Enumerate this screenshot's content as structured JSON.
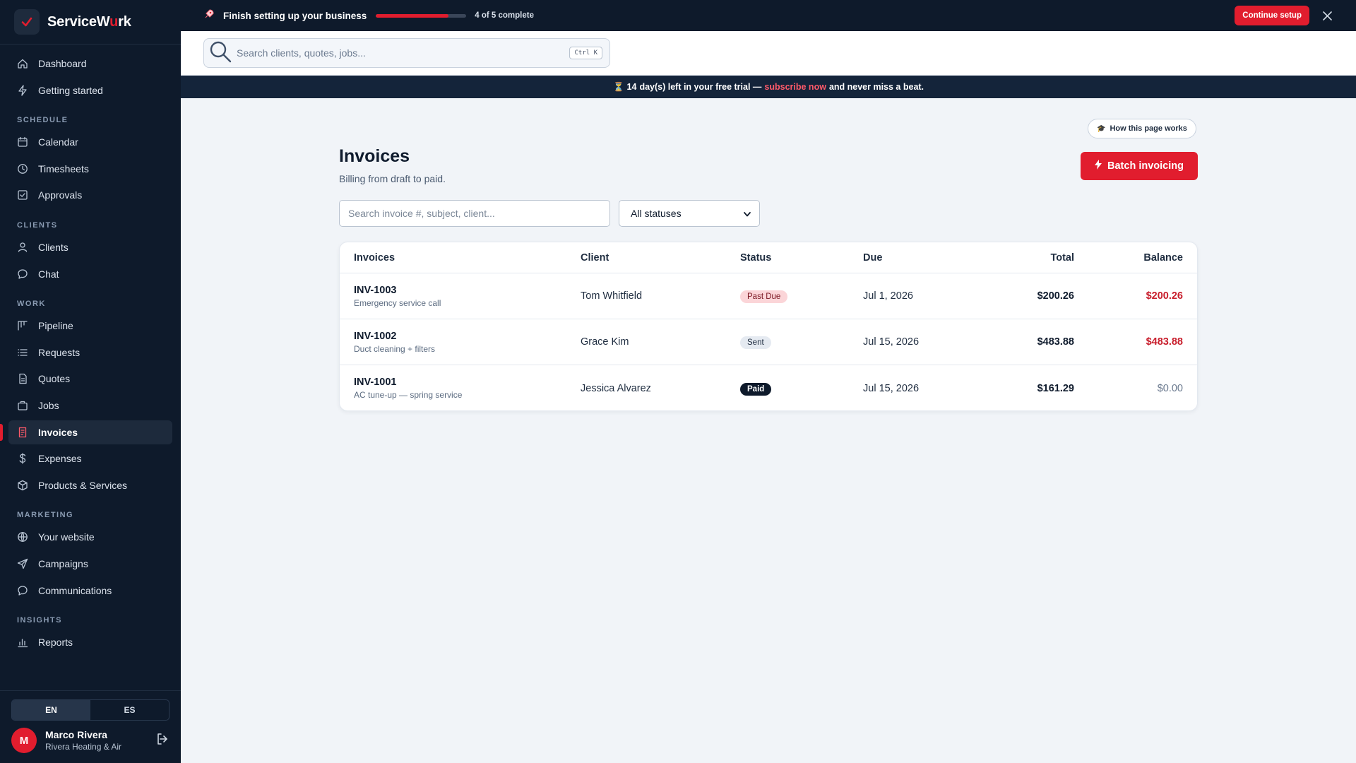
{
  "brand": {
    "name_prefix": "ServiceW",
    "name_accent": "u",
    "name_suffix": "rk"
  },
  "sidebar": {
    "top": [
      {
        "label": "Dashboard",
        "icon": "home-icon"
      },
      {
        "label": "Getting started",
        "icon": "bolt-icon"
      }
    ],
    "sections": [
      {
        "title": "SCHEDULE",
        "items": [
          {
            "label": "Calendar",
            "icon": "calendar-icon"
          },
          {
            "label": "Timesheets",
            "icon": "clock-icon"
          },
          {
            "label": "Approvals",
            "icon": "check-square-icon"
          }
        ]
      },
      {
        "title": "CLIENTS",
        "items": [
          {
            "label": "Clients",
            "icon": "user-icon"
          },
          {
            "label": "Chat",
            "icon": "chat-icon"
          }
        ]
      },
      {
        "title": "WORK",
        "items": [
          {
            "label": "Pipeline",
            "icon": "kanban-icon"
          },
          {
            "label": "Requests",
            "icon": "list-icon"
          },
          {
            "label": "Quotes",
            "icon": "file-icon"
          },
          {
            "label": "Jobs",
            "icon": "briefcase-icon"
          },
          {
            "label": "Invoices",
            "icon": "invoice-icon",
            "active": true
          },
          {
            "label": "Expenses",
            "icon": "dollar-icon"
          },
          {
            "label": "Products & Services",
            "icon": "box-icon"
          }
        ]
      },
      {
        "title": "MARKETING",
        "items": [
          {
            "label": "Your website",
            "icon": "globe-icon"
          },
          {
            "label": "Campaigns",
            "icon": "send-icon"
          },
          {
            "label": "Communications",
            "icon": "chat-icon"
          }
        ]
      },
      {
        "title": "INSIGHTS",
        "items": [
          {
            "label": "Reports",
            "icon": "bar-chart-icon"
          }
        ]
      }
    ],
    "lang": {
      "en": "EN",
      "es": "ES",
      "selected": "EN"
    },
    "user": {
      "initial": "M",
      "name": "Marco Rivera",
      "company": "Rivera Heating & Air"
    }
  },
  "setup": {
    "title": "Finish setting up your business",
    "progress_fraction": 0.8,
    "count": "4 of 5 complete",
    "continue_label": "Continue setup"
  },
  "search": {
    "placeholder": "Search clients, quotes, jobs...",
    "shortcut": "Ctrl K"
  },
  "trial": {
    "icon": "⏳",
    "days": "14",
    "text_before": " day(s) left in your free trial —",
    "link": "subscribe now",
    "text_after": "and never miss a beat."
  },
  "page": {
    "help_label": "How this page works",
    "title": "Invoices",
    "subtitle": "Billing from draft to paid.",
    "batch_label": "Batch invoicing",
    "filter_placeholder": "Search invoice #, subject, client...",
    "status_selected": "All statuses"
  },
  "table": {
    "headers": {
      "invoice": "Invoices",
      "client": "Client",
      "status": "Status",
      "due": "Due",
      "total": "Total",
      "balance": "Balance"
    },
    "rows": [
      {
        "number": "INV-1003",
        "subject": "Emergency service call",
        "client": "Tom Whitfield",
        "status": "Past Due",
        "status_kind": "pastdue",
        "due": "Jul 1, 2026",
        "total": "$200.26",
        "balance": "$200.26",
        "balance_kind": "red"
      },
      {
        "number": "INV-1002",
        "subject": "Duct cleaning + filters",
        "client": "Grace Kim",
        "status": "Sent",
        "status_kind": "sent",
        "due": "Jul 15, 2026",
        "total": "$483.88",
        "balance": "$483.88",
        "balance_kind": "red"
      },
      {
        "number": "INV-1001",
        "subject": "AC tune-up — spring service",
        "client": "Jessica Alvarez",
        "status": "Paid",
        "status_kind": "paid",
        "due": "Jul 15, 2026",
        "total": "$161.29",
        "balance": "$0.00",
        "balance_kind": "grey"
      }
    ]
  },
  "colors": {
    "accent": "#e11d2e",
    "sidebar_bg": "#0e1a2b"
  }
}
